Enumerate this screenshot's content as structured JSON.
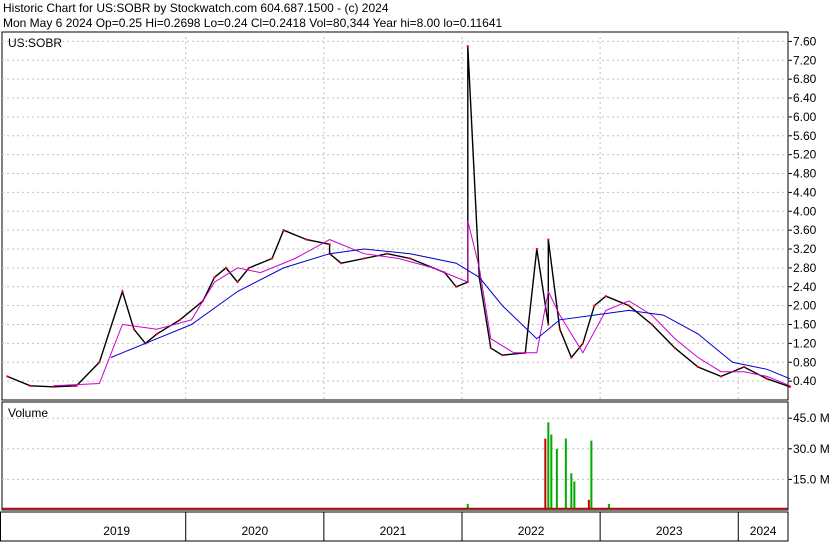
{
  "header": {
    "line1": "Historic Chart for US:SOBR by Stockwatch.com 604.687.1500 - (c) 2024",
    "line2": "Mon May  6 2024   Op=0.25  Hi=0.2698  Lo=0.24  Cl=0.2418  Vol=80,344  Year hi=8.00  lo=0.11641"
  },
  "colors": {
    "price": "#000000",
    "ma_short": "#cc00cc",
    "ma_long": "#0000cc",
    "close_marks": "#ff0000",
    "volume_up": "#00aa00",
    "volume_down": "#cc0000",
    "grid": "#c0c0c0"
  },
  "chart_data": [
    {
      "type": "line",
      "title": "US:SOBR",
      "y_scale": "linear",
      "ylim": [
        0.0,
        7.8
      ],
      "y_ticks": [
        "7.60",
        "7.20",
        "6.80",
        "6.40",
        "6.00",
        "5.60",
        "5.20",
        "4.80",
        "4.40",
        "4.00",
        "3.60",
        "3.20",
        "2.80",
        "2.40",
        "2.00",
        "1.60",
        "1.20",
        "0.80",
        "0.40"
      ],
      "x_labels": [
        "2019",
        "2020",
        "2021",
        "2022",
        "2023",
        "2024"
      ],
      "grid": true,
      "series": [
        {
          "role": "price",
          "x": [
            "2018-09",
            "2018-11",
            "2019-01",
            "2019-03",
            "2019-05",
            "2019-07",
            "2019-08",
            "2019-09",
            "2019-10",
            "2019-12",
            "2020-02",
            "2020-03",
            "2020-04",
            "2020-05",
            "2020-06",
            "2020-08",
            "2020-09",
            "2020-11",
            "2021-01",
            "2021-01",
            "2021-02",
            "2021-04",
            "2021-06",
            "2021-08",
            "2021-10",
            "2021-11",
            "2021-12",
            "2022-01",
            "2022-01",
            "2022-02",
            "2022-03",
            "2022-04",
            "2022-06",
            "2022-07",
            "2022-08",
            "2022-08",
            "2022-09",
            "2022-10",
            "2022-11",
            "2022-12",
            "2023-01",
            "2023-03",
            "2023-05",
            "2023-07",
            "2023-09",
            "2023-11",
            "2024-01",
            "2024-03",
            "2024-05"
          ],
          "values": [
            0.5,
            0.3,
            0.28,
            0.3,
            0.8,
            2.3,
            1.5,
            1.2,
            1.4,
            1.7,
            2.1,
            2.6,
            2.8,
            2.5,
            2.8,
            3.0,
            3.6,
            3.4,
            3.3,
            3.1,
            2.9,
            3.0,
            3.1,
            3.0,
            2.8,
            2.7,
            2.4,
            2.5,
            7.5,
            2.6,
            1.1,
            0.95,
            1.0,
            3.2,
            1.6,
            3.4,
            1.5,
            0.9,
            1.2,
            2.0,
            2.2,
            2.0,
            1.6,
            1.1,
            0.7,
            0.5,
            0.7,
            0.45,
            0.28
          ]
        },
        {
          "role": "ma_short",
          "x": [
            "2019-01",
            "2019-05",
            "2019-07",
            "2019-10",
            "2020-01",
            "2020-03",
            "2020-05",
            "2020-07",
            "2020-10",
            "2021-01",
            "2021-04",
            "2021-07",
            "2021-10",
            "2022-01",
            "2022-01",
            "2022-02",
            "2022-03",
            "2022-05",
            "2022-07",
            "2022-08",
            "2022-09",
            "2022-11",
            "2023-01",
            "2023-03",
            "2023-05",
            "2023-07",
            "2023-09",
            "2023-11",
            "2024-01",
            "2024-03",
            "2024-05"
          ],
          "values": [
            0.3,
            0.35,
            1.6,
            1.5,
            1.7,
            2.5,
            2.8,
            2.7,
            3.0,
            3.4,
            3.1,
            3.0,
            2.8,
            2.5,
            3.8,
            2.8,
            1.3,
            1.0,
            1.0,
            2.3,
            1.8,
            1.0,
            1.9,
            2.1,
            1.8,
            1.3,
            0.9,
            0.6,
            0.6,
            0.5,
            0.3
          ]
        },
        {
          "role": "ma_long",
          "x": [
            "2019-06",
            "2019-10",
            "2020-01",
            "2020-05",
            "2020-09",
            "2021-01",
            "2021-04",
            "2021-08",
            "2021-12",
            "2022-02",
            "2022-04",
            "2022-07",
            "2022-09",
            "2022-12",
            "2023-03",
            "2023-06",
            "2023-09",
            "2023-12",
            "2024-03",
            "2024-05"
          ],
          "values": [
            0.9,
            1.3,
            1.6,
            2.3,
            2.8,
            3.1,
            3.2,
            3.1,
            2.9,
            2.6,
            2.0,
            1.3,
            1.7,
            1.8,
            1.9,
            1.8,
            1.4,
            0.8,
            0.65,
            0.45
          ]
        }
      ]
    },
    {
      "type": "bar",
      "title": "Volume",
      "ylim": [
        0,
        50
      ],
      "y_ticks": [
        "45.0 M",
        "30.0 M",
        "15.0 M"
      ],
      "bars": [
        {
          "x": "2022-08",
          "value": 35,
          "dir": "down"
        },
        {
          "x": "2022-08",
          "value": 43,
          "dir": "up"
        },
        {
          "x": "2022-08",
          "value": 37,
          "dir": "up"
        },
        {
          "x": "2022-09",
          "value": 35,
          "dir": "up"
        },
        {
          "x": "2022-09",
          "value": 30,
          "dir": "up"
        },
        {
          "x": "2022-10",
          "value": 18,
          "dir": "up"
        },
        {
          "x": "2022-10",
          "value": 14,
          "dir": "up"
        },
        {
          "x": "2022-11",
          "value": 5,
          "dir": "down"
        },
        {
          "x": "2022-12",
          "value": 34,
          "dir": "up"
        },
        {
          "x": "2022-01",
          "value": 3,
          "dir": "up"
        },
        {
          "x": "2023-01",
          "value": 3,
          "dir": "up"
        }
      ]
    }
  ]
}
